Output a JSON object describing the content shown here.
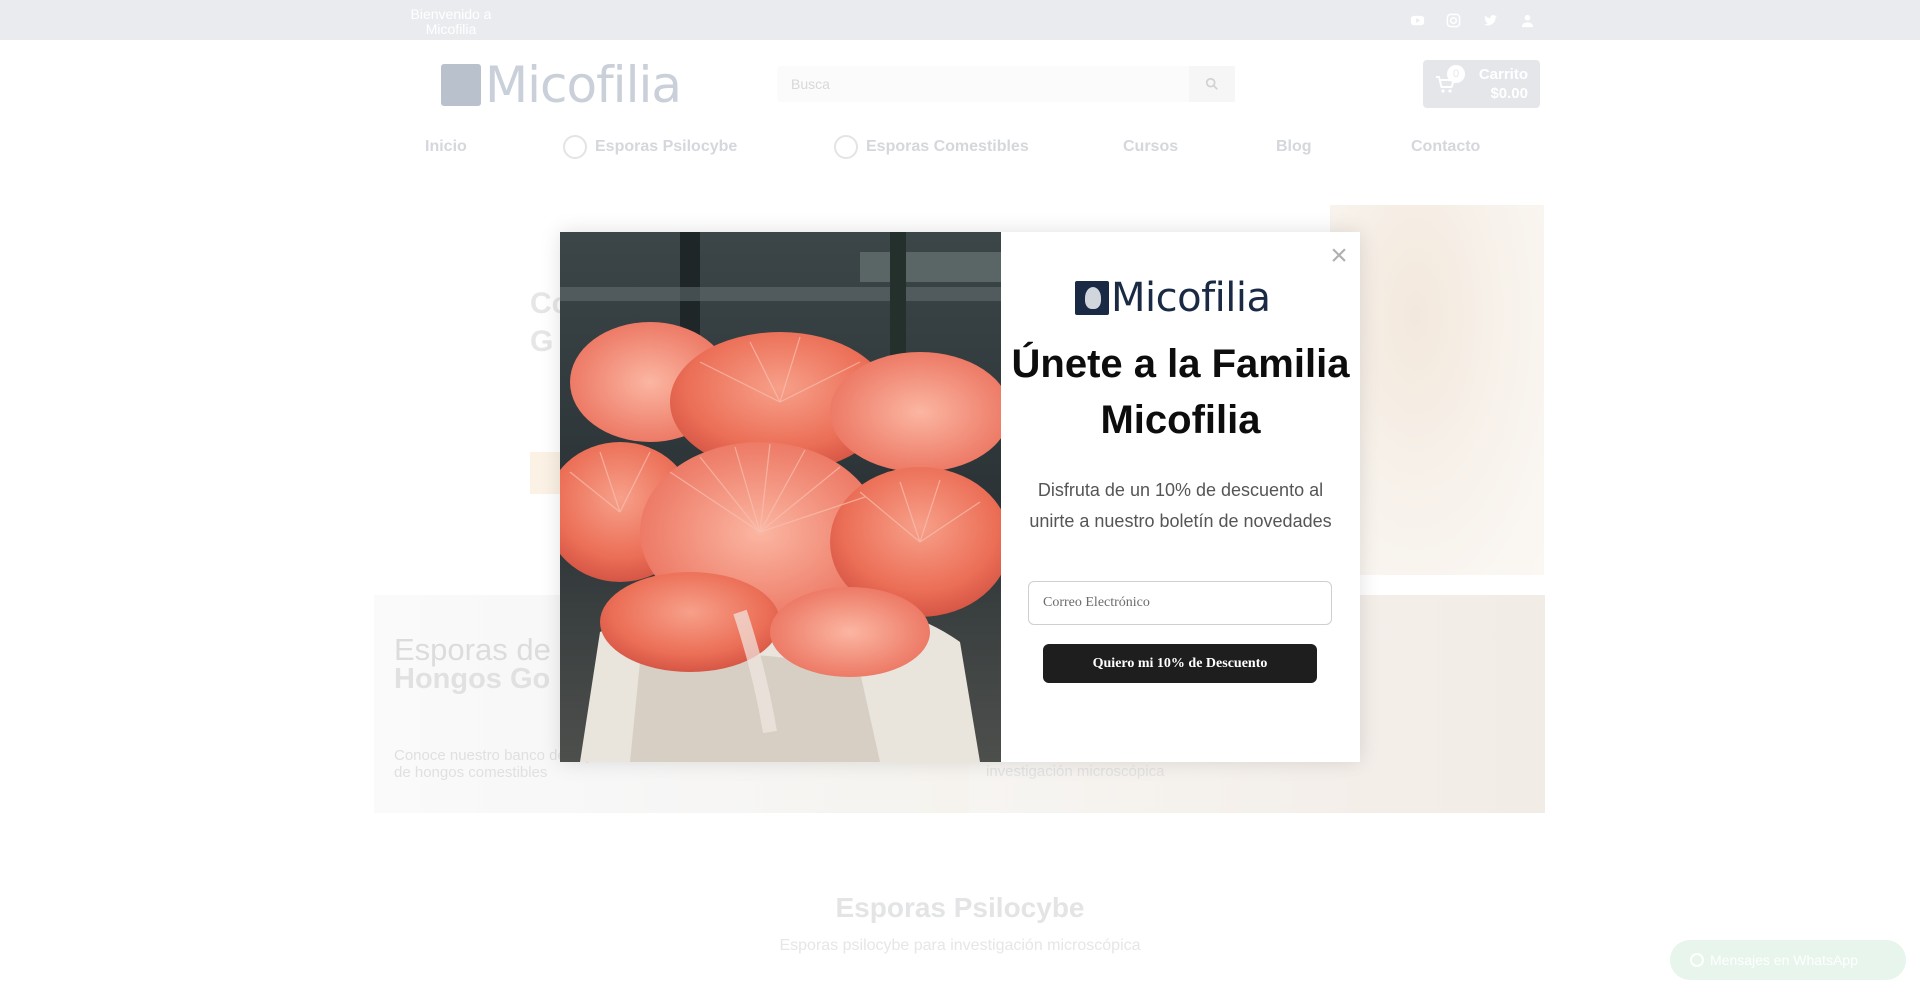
{
  "topbar": {
    "welcome": "Bienvenido a Micofilia",
    "icons": [
      "youtube-icon",
      "instagram-icon",
      "twitter-icon",
      "user-icon"
    ]
  },
  "header": {
    "logo_text": "Micofilia",
    "search_placeholder": "Busca",
    "cart": {
      "count": "0",
      "label": "Carrito",
      "total": "$0.00"
    }
  },
  "nav": {
    "items": [
      {
        "label": "Inicio"
      },
      {
        "label": "Esporas Psilocybe"
      },
      {
        "label": "Esporas Comestibles"
      },
      {
        "label": "Cursos"
      },
      {
        "label": "Blog"
      },
      {
        "label": "Contacto"
      }
    ]
  },
  "hero": {
    "title_line1": "Co",
    "title_line2": "G"
  },
  "banners": {
    "left": {
      "title1": "Esporas de",
      "title2": "Hongos Go",
      "desc": "Conoce nuestro banco de cepas de hongos comestibles"
    },
    "right": {
      "desc": "investigación microscópica"
    }
  },
  "section": {
    "title": "Esporas Psilocybe",
    "subtitle": "Esporas psilocybe para investigación microscópica"
  },
  "whatsapp": {
    "label": "Mensajes en WhatsApp"
  },
  "modal": {
    "logo_text": "Micofilia",
    "title": "Únete a la Familia Micofilia",
    "description": "Disfruta de un 10% de descuento al unirte a nuestro boletín de novedades",
    "email_placeholder": "Correo Electrónico",
    "button_label": "Quiero mi 10% de Descuento",
    "close_label": "×"
  },
  "colors": {
    "brand_navy": "#1b2a44",
    "button_dark": "#1e1e1e",
    "topbar_bg": "#e9ebee"
  }
}
